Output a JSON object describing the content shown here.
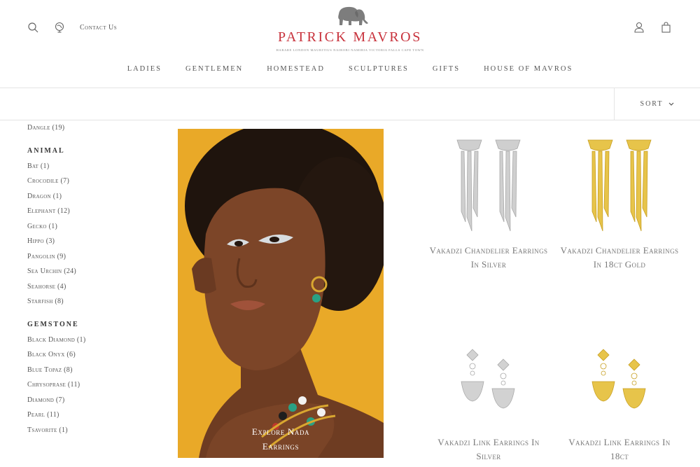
{
  "header": {
    "contact_label": "Contact Us",
    "logo_title": "PATRICK MAVROS",
    "logo_subtitle": "HARARE LONDON MAURITIUS NAIROBI NAMIBIA VICTORIA FALLS CAPE TOWN"
  },
  "nav": [
    "Ladies",
    "Gentlemen",
    "Homestead",
    "Sculptures",
    "Gifts",
    "House of Mavros"
  ],
  "sort": {
    "label": "Sort"
  },
  "sidebar": {
    "top_item": "Dangle (19)",
    "animal": {
      "heading": "Animal",
      "items": [
        "Bat (1)",
        "Crocodile (7)",
        "Dragon (1)",
        "Elephant (12)",
        "Gecko (1)",
        "Hippo (3)",
        "Pangolin (9)",
        "Sea Urchin (24)",
        "Seahorse (4)",
        "Starfish (8)"
      ]
    },
    "gemstone": {
      "heading": "Gemstone",
      "items": [
        "Black Diamond (1)",
        "Black Onyx (6)",
        "Blue Topaz (8)",
        "Chrysoprase (11)",
        "Diamond (7)",
        "Pearl (11)",
        "Tsavorite (1)"
      ]
    }
  },
  "promo": {
    "caption_line1": "Explore Nada",
    "caption_line2": "Earrings"
  },
  "products": [
    {
      "name": "Vakadzi Chandelier Earrings In Silver",
      "metal": "silver"
    },
    {
      "name": "Vakadzi Chandelier Earrings In 18ct Gold",
      "metal": "gold"
    },
    {
      "name": "Vakadzi Link Earrings In Silver",
      "metal": "silver"
    },
    {
      "name": "Vakadzi Link Earrings In 18ct",
      "metal": "gold"
    }
  ],
  "colors": {
    "brand_red": "#c8323c",
    "promo_bg": "#e9a928",
    "silver": "#c9c9c9",
    "gold": "#e0bd3c"
  }
}
